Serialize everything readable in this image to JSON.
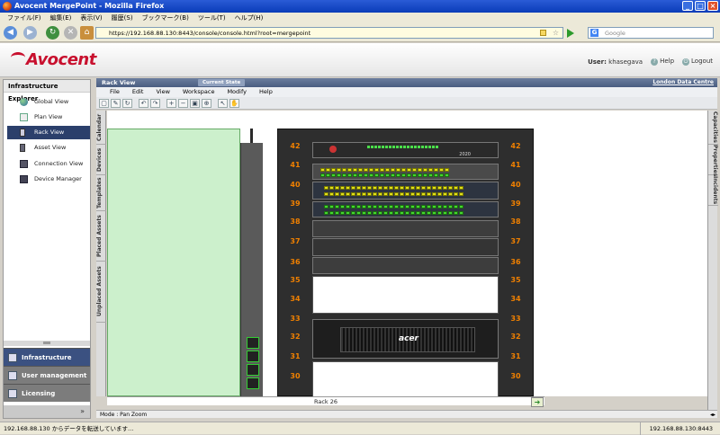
{
  "window": {
    "title": "Avocent MergePoint - Mozilla Firefox",
    "min": "_",
    "max": "□",
    "close": "×"
  },
  "menubar": [
    "ファイル(F)",
    "編集(E)",
    "表示(V)",
    "履歴(S)",
    "ブックマーク(B)",
    "ツール(T)",
    "ヘルプ(H)"
  ],
  "nav": {
    "url": "https://192.168.88.130:8443/console/console.html?root=mergepoint",
    "search_placeholder": "Google",
    "search_engine": "G"
  },
  "app": {
    "brand": "Avocent",
    "user_label": "User:",
    "user_name": "khasegava",
    "help": "Help",
    "logout": "Logout"
  },
  "sidebar": {
    "title": "Infrastructure Explorer",
    "items": [
      {
        "label": "Global View",
        "icon": "globe-icon",
        "active": false
      },
      {
        "label": "Plan View",
        "icon": "plan-icon",
        "active": false
      },
      {
        "label": "Rack View",
        "icon": "rack-icon",
        "active": true
      },
      {
        "label": "Asset View",
        "icon": "asset-icon",
        "active": false
      },
      {
        "label": "Connection View",
        "icon": "connection-icon",
        "active": false
      },
      {
        "label": "Device Manager",
        "icon": "device-manager-icon",
        "active": false
      }
    ],
    "bottom": [
      {
        "label": "Infrastructure Explo...",
        "selected": true
      },
      {
        "label": "User management",
        "selected": false
      },
      {
        "label": "Licensing",
        "selected": false
      }
    ],
    "expand": "»"
  },
  "rackview": {
    "title": "Rack View",
    "state_badge": "Current State",
    "datacenter": "London Data Centre",
    "menu": [
      "File",
      "Edit",
      "View",
      "Workspace",
      "Modify",
      "Help"
    ],
    "left_tabs": [
      "Calendar",
      "Devices",
      "Templates",
      "Placed Assets",
      "Unplaced Assets"
    ],
    "right_tabs": [
      "Capacities",
      "Properties",
      "Incidents"
    ],
    "rack_units": [
      "42",
      "41",
      "40",
      "39",
      "38",
      "37",
      "36",
      "35",
      "34",
      "33",
      "32",
      "31",
      "30"
    ],
    "rack_label": "Rack 26",
    "mode": "Mode : Pan Zoom",
    "server_brand": "acer",
    "switch_label": "2020"
  },
  "statusbar": {
    "left": "192.168.88.130 からデータを転送しています...",
    "right": "192.168.88.130:8443"
  },
  "colors": {
    "accent": "#2b3f6b",
    "brand_red": "#c8102e",
    "rack_unit_orange": "#f08000",
    "port_yellow": "#dfe01b",
    "port_green": "#43d62e"
  }
}
